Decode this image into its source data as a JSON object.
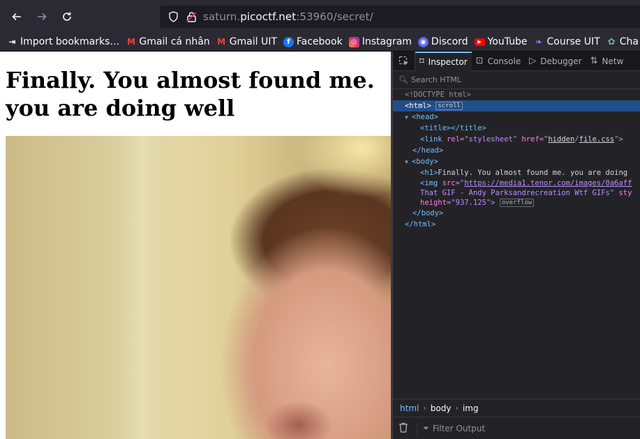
{
  "browser": {
    "url_prefix": "saturn.",
    "url_host": "picoctf.net",
    "url_suffix": ":53960/secret/"
  },
  "bookmarks": [
    {
      "label": "Import bookmarks…",
      "icon": "import-icon"
    },
    {
      "label": "Gmail cá nhân",
      "icon": "gmail-icon"
    },
    {
      "label": "Gmail UIT",
      "icon": "gmail-icon"
    },
    {
      "label": "Facebook",
      "icon": "facebook-icon"
    },
    {
      "label": "Instagram",
      "icon": "instagram-icon"
    },
    {
      "label": "Discord",
      "icon": "discord-icon"
    },
    {
      "label": "YouTube",
      "icon": "youtube-icon"
    },
    {
      "label": "Course UIT",
      "icon": "course-icon"
    },
    {
      "label": "Cha",
      "icon": "chatgpt-icon"
    }
  ],
  "page": {
    "heading": "Finally. You almost found me. you are doing well"
  },
  "devtools": {
    "tabs": [
      "Inspector",
      "Console",
      "Debugger",
      "Netw"
    ],
    "search_placeholder": "Search HTML",
    "markup": {
      "doctype": "<!DOCTYPE html>",
      "html_open": "<html>",
      "scroll_badge": "scroll",
      "head_open": "<head>",
      "title": "<title></title>",
      "link_open": "<link ",
      "link_rel_attr": "rel=",
      "link_rel_val": "\"stylesheet\"",
      "link_href_attr": " href=",
      "link_href_q1": "\"",
      "link_href_dir": "hidden",
      "link_href_sep": "/",
      "link_href_file": "file.css",
      "link_href_q2": "\"",
      "link_close": ">",
      "head_close": "</head>",
      "body_open": "<body>",
      "h1_open": "<h1>",
      "h1_text": "Finally. You almost found me. you are doing",
      "img_open": "<img ",
      "img_src_attr": "src=",
      "img_src_q": "\"",
      "img_src_val": "https://media1.tenor.com/images/0a6aff",
      "img_alt_text": "That GIF - Andy Parksandrecreation Wtf GIFs\"",
      "img_alt_tail": " sty",
      "img_height_attr": "height=",
      "img_height_val": "\"937.125\"",
      "img_close": ">",
      "overflow_badge": "overflow",
      "body_close": "</body>",
      "html_close": "</html>"
    },
    "breadcrumbs": [
      "html",
      "body",
      "img"
    ],
    "filter_placeholder": "Filter Output"
  }
}
